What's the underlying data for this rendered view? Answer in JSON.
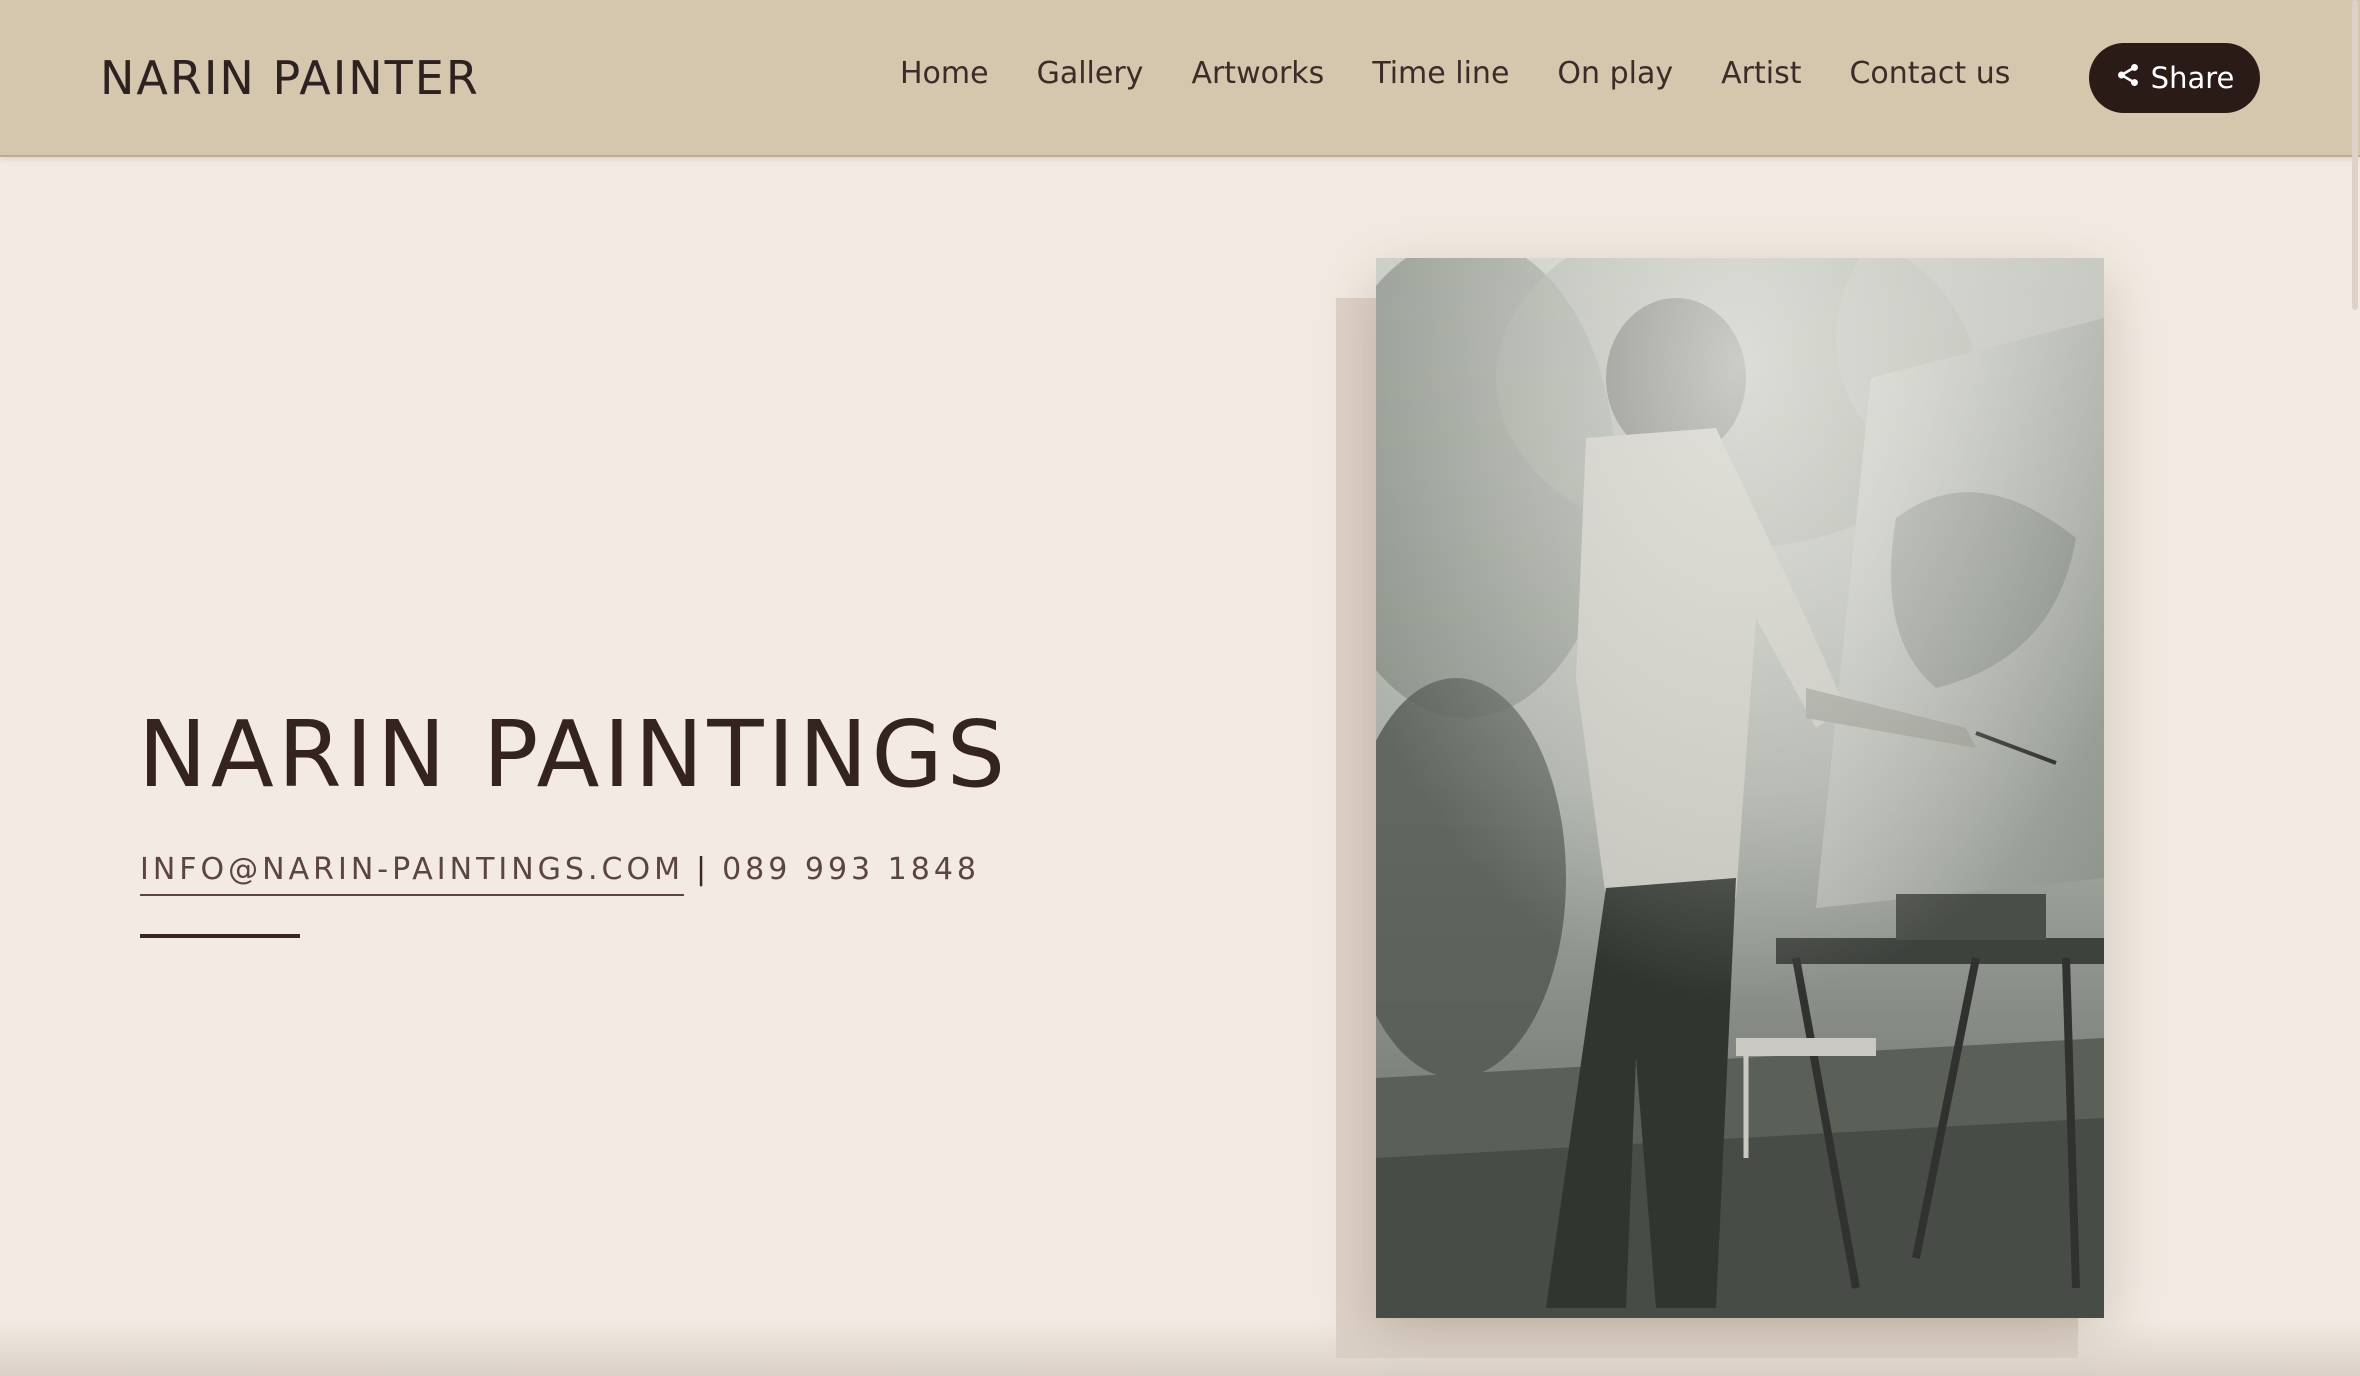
{
  "header": {
    "brand": "NARIN PAINTER",
    "nav": [
      {
        "label": "Home"
      },
      {
        "label": "Gallery"
      },
      {
        "label": "Artworks"
      },
      {
        "label": "Time line"
      },
      {
        "label": "On play"
      },
      {
        "label": "Artist"
      },
      {
        "label": "Contact us"
      }
    ],
    "share": {
      "label": "Share",
      "icon": "share-icon"
    }
  },
  "hero": {
    "title": "NARIN PAINTINGS",
    "email": "INFO@NARIN-PAINTINGS.COM",
    "separator": "|",
    "phone": "089 993 1848"
  },
  "colors": {
    "header_bg": "#d5c6ae",
    "page_bg": "#f3ebe3",
    "text_dark": "#35231f",
    "button_bg": "#2a1b17"
  }
}
